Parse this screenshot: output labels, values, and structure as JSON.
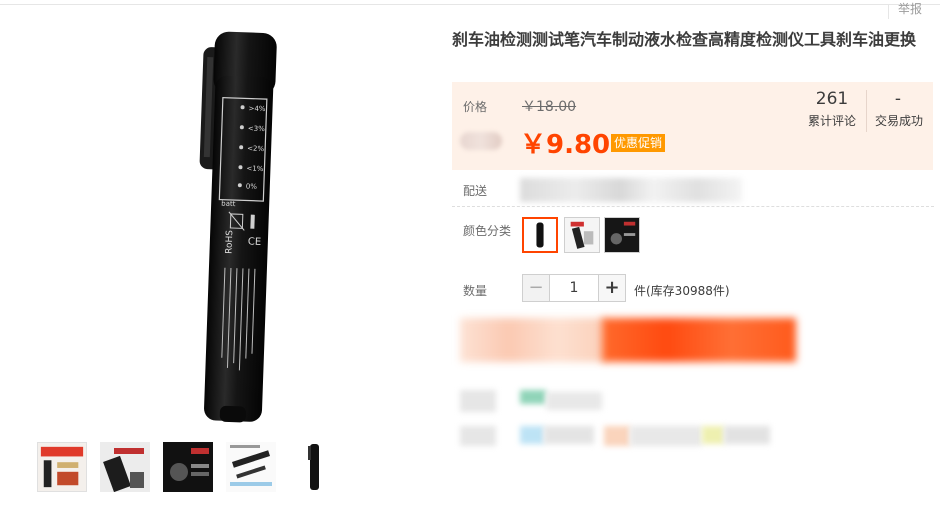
{
  "header": {
    "report_label": "举报"
  },
  "product": {
    "title": "刹车油检测测试笔汽车制动液水检查高精度检测仪工具刹车油更换"
  },
  "price": {
    "label": "价格",
    "original": "￥18.00",
    "promo": "￥9.80",
    "promo_tag": "优惠促销"
  },
  "stats": {
    "reviews_count": "261",
    "reviews_label": "累计评论",
    "deals_count": "-",
    "deals_label": "交易成功"
  },
  "delivery": {
    "label": "配送"
  },
  "color": {
    "label": "颜色分类",
    "selected_index": 0,
    "swatch_icons": [
      "pen-front-icon",
      "pen-package-icon",
      "pen-box-icon"
    ]
  },
  "quantity": {
    "label": "数量",
    "value": "1",
    "minus": "−",
    "plus": "+",
    "stock": "件(库存30988件)"
  },
  "gallery": {
    "thumb_icons": [
      "poster-thumb-icon",
      "pen-closeup-thumb-icon",
      "dark-box-thumb-icon",
      "product-detail-thumb-icon",
      "pen-thumb-icon"
    ]
  },
  "colors": {
    "accent": "#ff4400",
    "tag": "#ff9900",
    "panel": "#fef1e8"
  }
}
